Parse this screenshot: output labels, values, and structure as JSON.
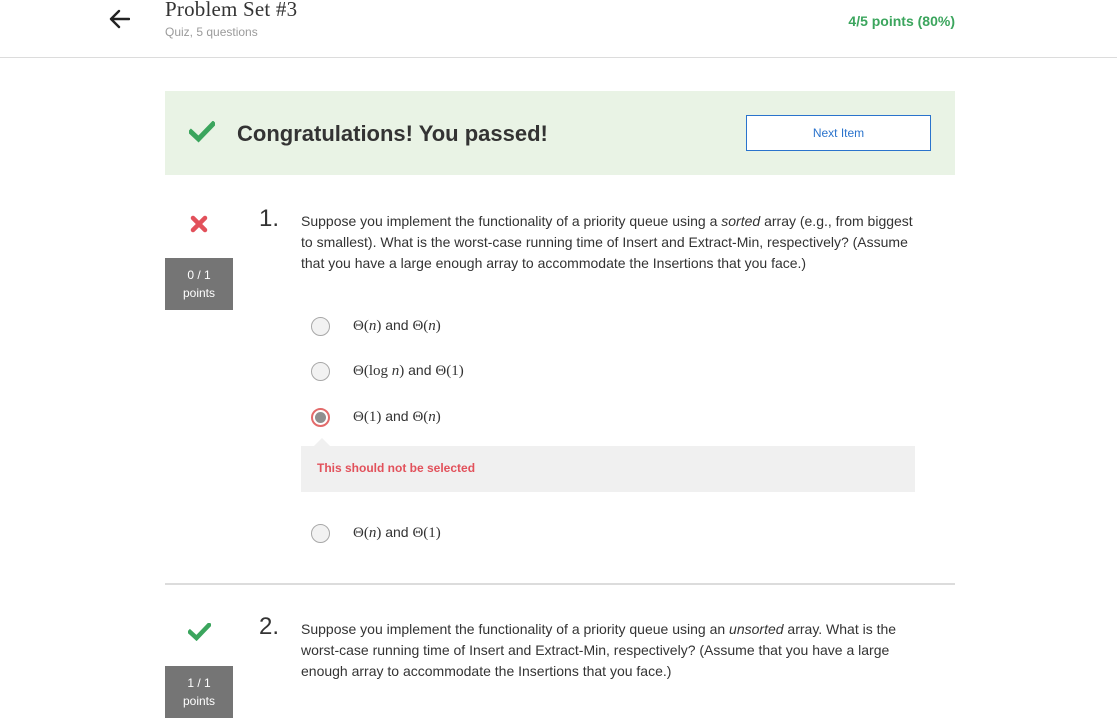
{
  "header": {
    "title": "Problem Set #3",
    "subtitle": "Quiz, 5 questions",
    "score": "4/5 points (80%)"
  },
  "banner": {
    "message": "Congratulations! You passed!",
    "next_button": "Next Item"
  },
  "questions": [
    {
      "number": "1.",
      "points_score": "0 / 1",
      "points_label": "points",
      "status": "incorrect",
      "text_before": "Suppose you implement the functionality of a priority queue using a ",
      "text_emphasis": "sorted",
      "text_after": " array (e.g., from biggest to smallest). What is the worst-case running time of Insert and Extract-Min, respectively? (Assume that you have a large enough array to accommodate the Insertions that you face.)",
      "options": [
        {
          "left": "Θ(",
          "left_var": "n",
          "left_close": ")",
          "and": "and",
          "right": "Θ(",
          "right_var": "n",
          "right_close": ")"
        },
        {
          "left": "Θ(log ",
          "left_var": "n",
          "left_close": ")",
          "and": "and",
          "right": "Θ(1)",
          "right_var": "",
          "right_close": ""
        },
        {
          "left": "Θ(1)",
          "left_var": "",
          "left_close": "",
          "and": "and",
          "right": "Θ(",
          "right_var": "n",
          "right_close": ")"
        },
        {
          "left": "Θ(",
          "left_var": "n",
          "left_close": ")",
          "and": "and",
          "right": "Θ(1)",
          "right_var": "",
          "right_close": ""
        }
      ],
      "selected_option": 2,
      "feedback": "This should not be selected"
    },
    {
      "number": "2.",
      "points_score": "1 / 1",
      "points_label": "points",
      "status": "correct",
      "text_before": "Suppose you implement the functionality of a priority queue using an ",
      "text_emphasis": "unsorted",
      "text_after": " array. What is the worst-case running time of Insert and Extract-Min, respectively? (Assume that you have a large enough array to accommodate the Insertions that you face.)"
    }
  ],
  "colors": {
    "success_green": "#3ba55d",
    "error_red": "#e2515b",
    "link_blue": "#2a73cc",
    "banner_bg": "#e9f3e5",
    "points_box_bg": "#757575"
  },
  "icons": {
    "back": "arrow-left-icon",
    "passed": "checkmark-icon",
    "incorrect": "x-mark-icon",
    "correct": "checkmark-icon"
  }
}
